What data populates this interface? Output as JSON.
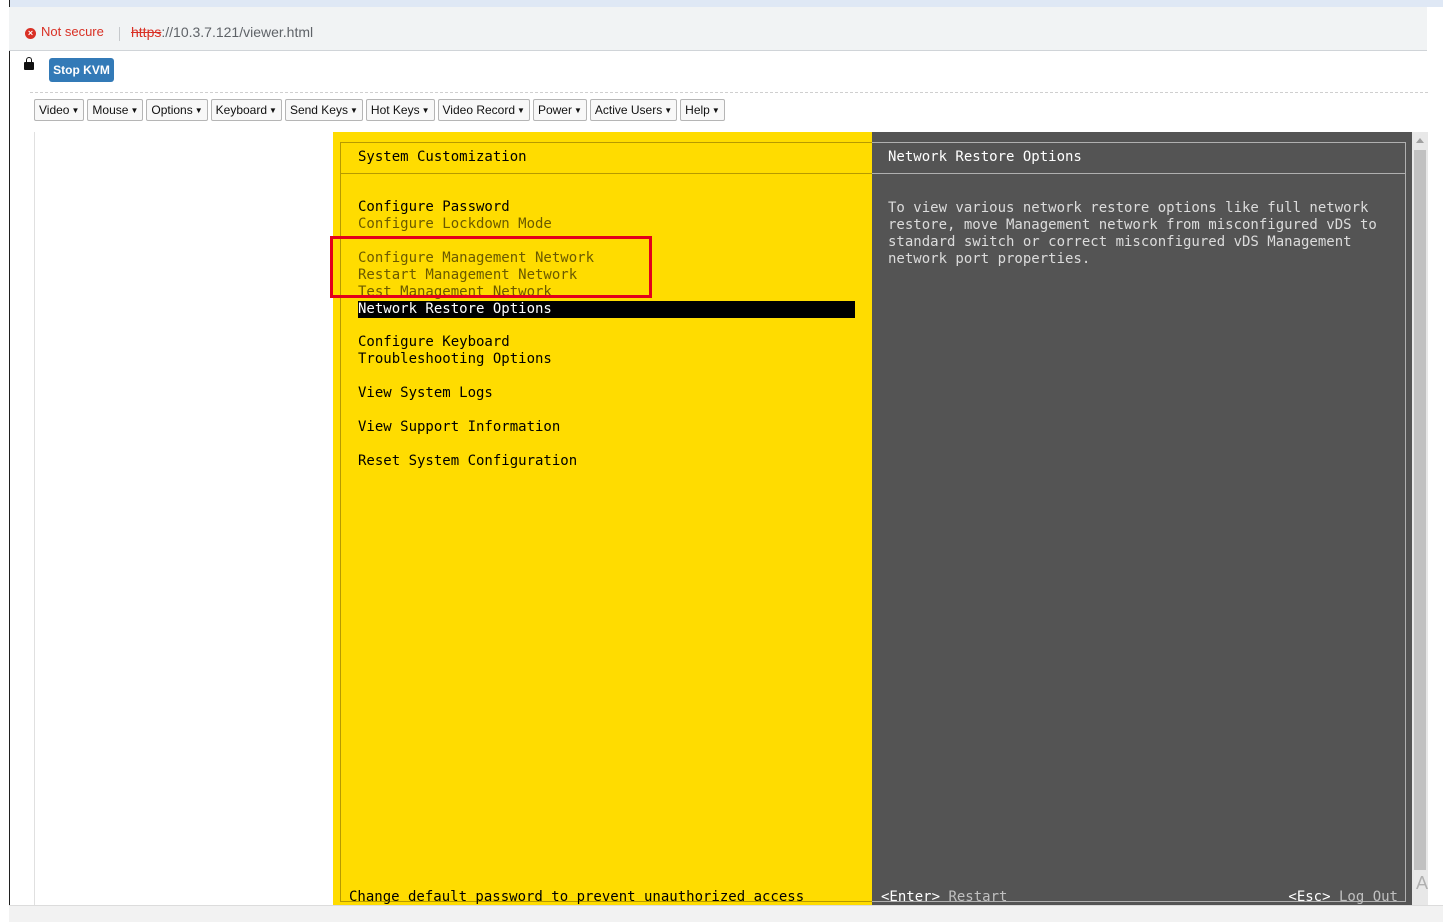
{
  "browser": {
    "security_label": "Not secure",
    "url_scheme": "https",
    "url_rest": "://10.3.7.121/viewer.html"
  },
  "kvm": {
    "stop_label": "Stop KVM"
  },
  "menubar": [
    {
      "label": "Video"
    },
    {
      "label": "Mouse"
    },
    {
      "label": "Options"
    },
    {
      "label": "Keyboard"
    },
    {
      "label": "Send Keys"
    },
    {
      "label": "Hot Keys"
    },
    {
      "label": "Video Record"
    },
    {
      "label": "Power"
    },
    {
      "label": "Active Users"
    },
    {
      "label": "Help"
    }
  ],
  "dcui": {
    "left_title": "System Customization",
    "right_title": "Network Restore Options",
    "menu": [
      {
        "label": "Configure Password",
        "dim": false
      },
      {
        "label": "Configure Lockdown Mode",
        "dim": true
      },
      {
        "label": "Configure Management Network",
        "dim": true
      },
      {
        "label": "Restart Management Network",
        "dim": true
      },
      {
        "label": "Test Management Network",
        "dim": true
      },
      {
        "label": "Network Restore Options",
        "selected": true
      },
      {
        "label": "Configure Keyboard"
      },
      {
        "label": "Troubleshooting Options"
      },
      {
        "label": "View System Logs"
      },
      {
        "label": "View Support Information"
      },
      {
        "label": "Reset System Configuration"
      }
    ],
    "description": "To view various network restore options like full network\nrestore, move Management network from misconfigured vDS to\nstandard switch or correct misconfigured vDS Management\nnetwork port properties.",
    "status_left": "Change default password to prevent unauthorized access",
    "enter_key": "<Enter>",
    "enter_action": "Restart",
    "esc_key": "<Esc>",
    "esc_action": "Log Out"
  },
  "colors": {
    "dcui_yellow": "#ffdc00",
    "dcui_gray": "#545454",
    "highlight_box": "#e3001b",
    "kvm_button": "#337ab7"
  }
}
